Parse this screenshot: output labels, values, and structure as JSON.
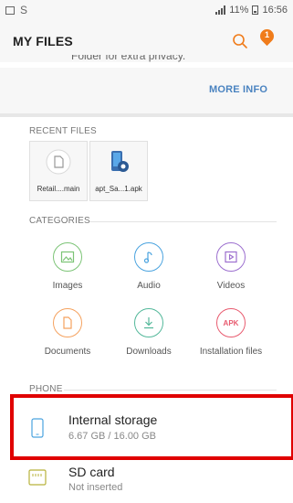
{
  "status_bar": {
    "battery": "11%",
    "time": "16:56"
  },
  "app_bar": {
    "title": "MY FILES",
    "notification_count": "1"
  },
  "cutoff_text": "Folder for extra privacy.",
  "more_info_label": "MORE INFO",
  "recent": {
    "label": "RECENT FILES",
    "items": [
      {
        "name": "Retail....main",
        "icon": "document-icon"
      },
      {
        "name": "apt_Sa...1.apk",
        "icon": "apk-app-icon"
      }
    ]
  },
  "categories": {
    "label": "CATEGORIES",
    "items": [
      {
        "label": "Images",
        "icon": "image-icon",
        "color": "#7cc476"
      },
      {
        "label": "Audio",
        "icon": "music-icon",
        "color": "#4aa3df"
      },
      {
        "label": "Videos",
        "icon": "video-icon",
        "color": "#9c6fcf"
      },
      {
        "label": "Documents",
        "icon": "document-icon",
        "color": "#f5a25f"
      },
      {
        "label": "Downloads",
        "icon": "download-icon",
        "color": "#53b89a"
      },
      {
        "label": "Installation files",
        "icon": "apk-icon",
        "color": "#e85b6f",
        "badge": "APK"
      }
    ]
  },
  "phone": {
    "label": "PHONE",
    "storage": [
      {
        "title": "Internal storage",
        "subtitle": "6.67 GB / 16.00 GB",
        "icon": "phone-icon",
        "color": "#4aa3df"
      },
      {
        "title": "SD card",
        "subtitle": "Not inserted",
        "icon": "sd-card-icon",
        "color": "#b7b23a"
      }
    ]
  }
}
